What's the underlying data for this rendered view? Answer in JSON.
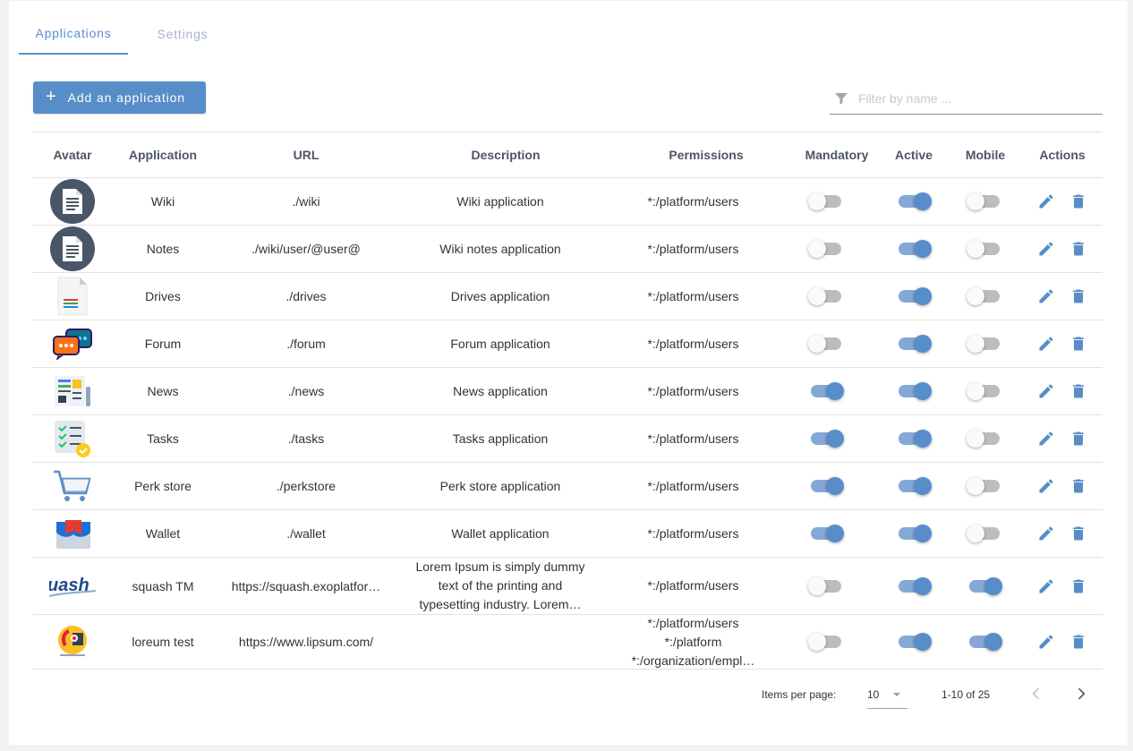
{
  "tabs": [
    {
      "label": "Applications",
      "active": true
    },
    {
      "label": "Settings",
      "active": false
    }
  ],
  "toolbar": {
    "add_label": "Add an application",
    "filter_placeholder": "Filter by name ..."
  },
  "table": {
    "headers": {
      "avatar": "Avatar",
      "application": "Application",
      "url": "URL",
      "description": "Description",
      "permissions": "Permissions",
      "mandatory": "Mandatory",
      "active": "Active",
      "mobile": "Mobile",
      "actions": "Actions"
    },
    "rows": [
      {
        "avatar": "wiki-avatar",
        "name": "Wiki",
        "url": "./wiki",
        "description": "Wiki application",
        "permissions": "*:/platform/users",
        "mandatory": false,
        "active": true,
        "mobile": false
      },
      {
        "avatar": "notes-avatar",
        "name": "Notes",
        "url": "./wiki/user/@user@",
        "description": "Wiki notes application",
        "permissions": "*:/platform/users",
        "mandatory": false,
        "active": true,
        "mobile": false
      },
      {
        "avatar": "drives-avatar",
        "name": "Drives",
        "url": "./drives",
        "description": "Drives application",
        "permissions": "*:/platform/users",
        "mandatory": false,
        "active": true,
        "mobile": false
      },
      {
        "avatar": "forum-avatar",
        "name": "Forum",
        "url": "./forum",
        "description": "Forum application",
        "permissions": "*:/platform/users",
        "mandatory": false,
        "active": true,
        "mobile": false
      },
      {
        "avatar": "news-avatar",
        "name": "News",
        "url": "./news",
        "description": "News application",
        "permissions": "*:/platform/users",
        "mandatory": true,
        "active": true,
        "mobile": false
      },
      {
        "avatar": "tasks-avatar",
        "name": "Tasks",
        "url": "./tasks",
        "description": "Tasks application",
        "permissions": "*:/platform/users",
        "mandatory": true,
        "active": true,
        "mobile": false
      },
      {
        "avatar": "perkstore-avatar",
        "name": "Perk store",
        "url": "./perkstore",
        "description": "Perk store application",
        "permissions": "*:/platform/users",
        "mandatory": true,
        "active": true,
        "mobile": false
      },
      {
        "avatar": "wallet-avatar",
        "name": "Wallet",
        "url": "./wallet",
        "description": "Wallet application",
        "permissions": "*:/platform/users",
        "mandatory": true,
        "active": true,
        "mobile": false
      },
      {
        "avatar": "squash-avatar",
        "avatar_text": "uash",
        "name": "squash TM",
        "url": "https://squash.exoplatfor…",
        "description": "Lorem Ipsum is simply dummy text of the printing and typesetting industry. Lorem…",
        "permissions": "*:/platform/users",
        "mandatory": false,
        "active": true,
        "mobile": true
      },
      {
        "avatar": "loreum-avatar",
        "name": "loreum test",
        "url": "https://www.lipsum.com/",
        "description": "",
        "permissions": "*:/platform/users\n*:/platform\n*:/organization/empl…",
        "mandatory": false,
        "active": true,
        "mobile": true
      }
    ]
  },
  "pagination": {
    "items_per_page_label": "Items per page:",
    "items_per_page_value": "10",
    "range_label": "1-10 of 25"
  },
  "colors": {
    "accent": "#578dc9",
    "switch_on_track": "#86a8d6",
    "header_text": "#4e5664"
  }
}
